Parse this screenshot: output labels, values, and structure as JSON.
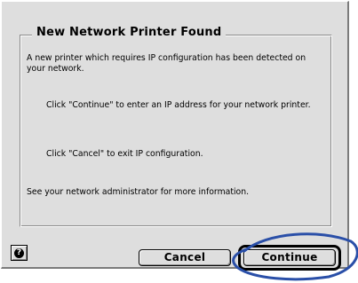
{
  "dialog": {
    "title": "New Network Printer Found",
    "message_1": "A new printer which requires IP configuration has been detected on your network.",
    "message_2": "Click \"Continue\" to enter an IP address for your network printer.",
    "message_3": "Click \"Cancel\" to exit IP configuration.",
    "message_4": "See your network administrator for more information.",
    "help_icon_glyph": "?",
    "cancel_label": "Cancel",
    "continue_label": "Continue",
    "annotation_color": "#2a4fa8"
  }
}
